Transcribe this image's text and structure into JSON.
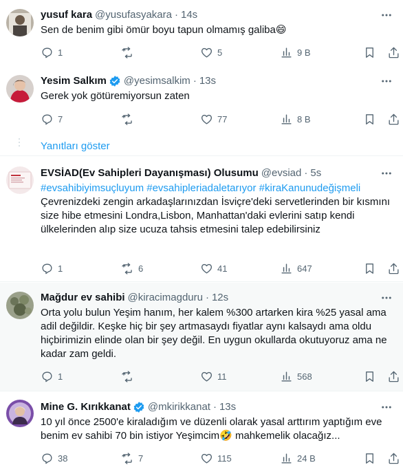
{
  "colors": {
    "accent": "#1d9bf0",
    "secondary": "#536471",
    "verified": "#1d9bf0",
    "highlight_bg": "#f7f9f9"
  },
  "show_replies_label": "Yanıtları göster",
  "tweets": [
    {
      "name": "yusuf kara",
      "handle": "@yusufasyakara",
      "time": "14s",
      "verified": false,
      "text": "Sen de benim gibi ömür boyu tapun olmamış galiba😄",
      "reply_count": "1",
      "retweet_count": "",
      "like_count": "5",
      "view_count": "9 B"
    },
    {
      "name": "Yesim Salkım",
      "handle": "@yesimsalkim",
      "time": "13s",
      "verified": true,
      "text": "Gerek yok götüremiyorsun zaten",
      "reply_count": "7",
      "retweet_count": "",
      "like_count": "77",
      "view_count": "8 B"
    },
    {
      "name": "EVSİAD(Ev Sahipleri Dayanışması) Olusumu",
      "handle": "@evsiad",
      "time": "5s",
      "verified": false,
      "hashtags": "#evsahibiyimsuçluyum #evsahipleriadaletarıyor #kiraKanunudeğişmeli",
      "text": "Çevrenizdeki zengin arkadaşlarınızdan İsviçre'deki servetlerinden bir kısmını size hibe etmesini Londra,Lisbon, Manhattan'daki evlerini satıp kendi ülkelerinden alıp size ucuza tahsis etmesini talep edebilirsiniz",
      "reply_count": "1",
      "retweet_count": "6",
      "like_count": "41",
      "view_count": "647"
    },
    {
      "name": "Mağdur ev sahibi",
      "handle": "@kiracimagduru",
      "time": "12s",
      "verified": false,
      "text": "Orta yolu bulun Yeşim hanım, her kalem %300 artarken kira %25 yasal ama adil değildir. Keşke hiç bir şey artmasaydı fiyatlar aynı kalsaydı ama oldu hiçbirimizin elinde olan bir şey değil. En uygun okullarda okutuyoruz ama ne kadar zam geldi.",
      "reply_count": "1",
      "retweet_count": "",
      "like_count": "11",
      "view_count": "568"
    },
    {
      "name": "Mine G. Kırıkkanat",
      "handle": "@mkirikkanat",
      "time": "13s",
      "verified": true,
      "text": "10 yıl önce 2500'e kiraladığım ve düzenli olarak yasal arttırım yaptığım eve benim ev sahibi 70 bin istiyor Yeşimcim🤣 mahkemelik olacağız...",
      "reply_count": "38",
      "retweet_count": "7",
      "like_count": "115",
      "view_count": "24 B"
    }
  ]
}
